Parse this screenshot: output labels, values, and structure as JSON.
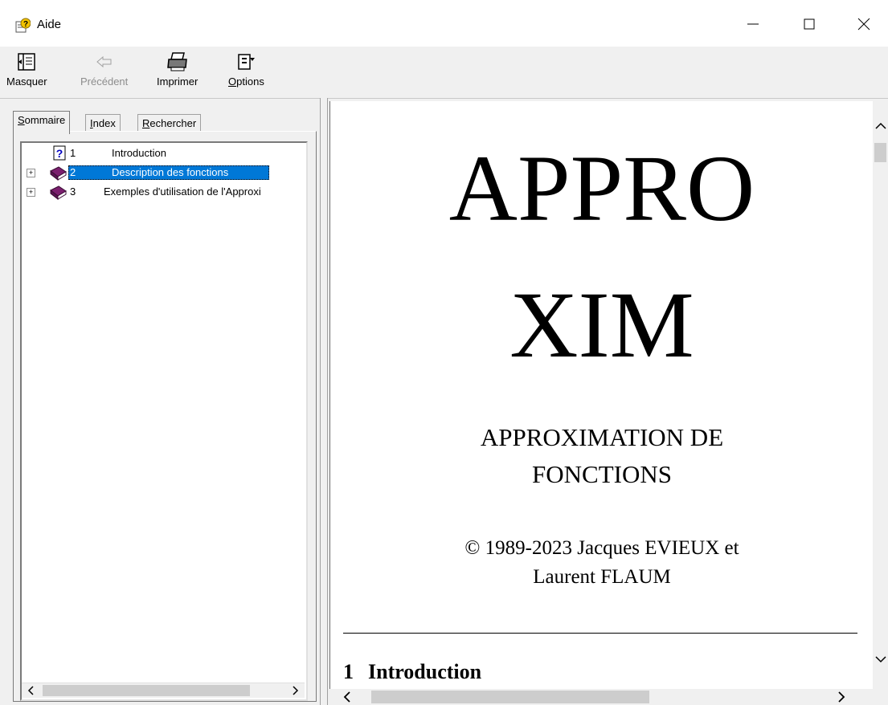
{
  "window": {
    "title": "Aide",
    "icon": "help-book-icon"
  },
  "toolbar": {
    "buttons": [
      {
        "label": "Masquer",
        "icon": "hide-pane-icon",
        "enabled": true
      },
      {
        "label": "Précédent",
        "icon": "back-arrow-icon",
        "enabled": false
      },
      {
        "label": "Imprimer",
        "icon": "printer-icon",
        "enabled": true
      },
      {
        "label": "Options",
        "icon": "options-icon",
        "enabled": true
      }
    ]
  },
  "tabs": [
    {
      "label": "Sommaire",
      "active": true
    },
    {
      "label": "Index",
      "active": false
    },
    {
      "label": "Rechercher",
      "active": false
    }
  ],
  "tree": [
    {
      "num": "1",
      "title": "Introduction",
      "icon": "help-page-icon",
      "expandable": false,
      "selected": false
    },
    {
      "num": "2",
      "title": "Description des fonctions",
      "icon": "book-icon",
      "expandable": true,
      "selected": true
    },
    {
      "num": "3",
      "title": "Exemples d'utilisation de l'Approxi",
      "icon": "book-icon",
      "expandable": true,
      "selected": false
    }
  ],
  "content": {
    "title_line1": "APPRO",
    "title_line2": "XIM",
    "subtitle_line1": "APPROXIMATION DE",
    "subtitle_line2": "FONCTIONS",
    "copyright_line1": "© 1989-2023 Jacques EVIEUX et",
    "copyright_line2": "Laurent FLAUM",
    "section_num": "1",
    "section_title": "Introduction"
  },
  "colors": {
    "selection": "#0078d7",
    "book": "#7b1f6e"
  }
}
